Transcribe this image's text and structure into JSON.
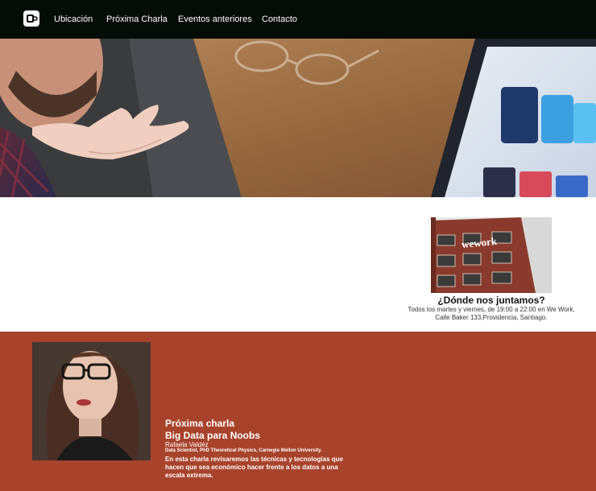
{
  "navbar": {
    "logo_icon": "coffee-cup-icon",
    "links": [
      "Ubicación",
      "Próxima Charla",
      "Eventos anteriores",
      "Contacto"
    ],
    "background": "#040c08"
  },
  "location": {
    "title": "¿Dónde nos juntamos?",
    "description": "Todos los martes y viernes, de 19:00 a 22:00 en We Work, Calle Baker 133,Providencia, Santiago.",
    "building_sign": "wework"
  },
  "talk": {
    "kicker": "Próxima charla",
    "title": "Big Data para Noobs",
    "speaker_name": "Rafaela Valdéz",
    "speaker_role": "Data Scientist, PhD Theoretical Physics, Carnegie Mellon University.",
    "description": "En esta charla revisaremos las técnicas y tecnologías que hacen que sea económico hacer frente a los datos a una escala extrema.",
    "background": "#a8432b"
  }
}
